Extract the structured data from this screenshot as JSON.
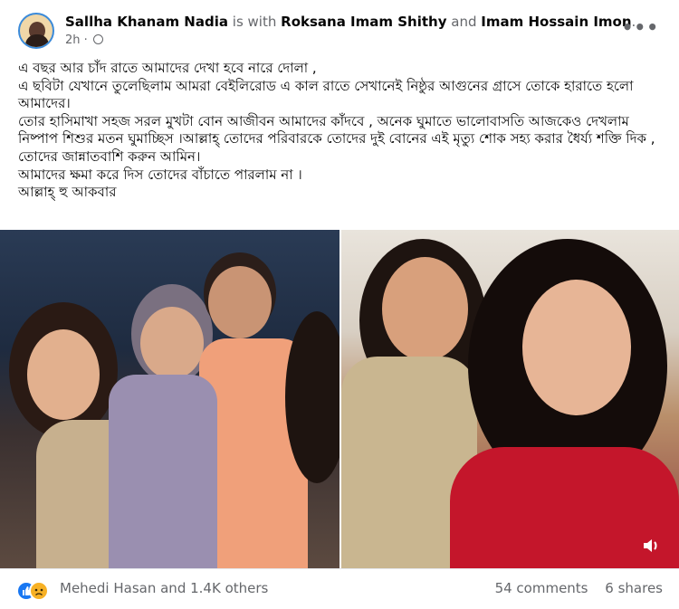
{
  "post": {
    "author": "Sallha Khanam Nadia",
    "with_text": "is with",
    "tagged_1": "Roksana Imam Shithy",
    "and_text": "and",
    "tagged_2": "Imam Hossain Imon",
    "period": ".",
    "time": "2h",
    "dot": "·",
    "more_label": "•••",
    "lines": [
      "এ বছর আর চাঁদ রাতে আমাদের দেখা হবে নারে দোলা ,",
      "এ ছবিটা যেখানে তুলেছিলাম আমরা বেইলিরোড এ কাল রাতে সেখানেই নিষ্ঠুর আগুনের গ্রাসে তোকে হারাতে হলো আমাদের।",
      "তোর হাসিমাখা সহজ সরল মুখটা বোন আজীবন আমাদের কাঁদবে , অনেক ঘুমাতে ভালোবাসতি আজকেও দেখলাম নিষ্পাপ শিশুর মতন ঘুমাচ্ছিস ।আল্লাহ্ তোদের পরিবারকে তোদের দুই বোনের এই মৃত্যু শোক সহ্য করার ধৈর্য্য শক্তি দিক , তোদের জান্নাতবাশি করুন আমিন।",
      "আমাদের ক্ষমা করে দিস তোদের বাঁচাতে পারলাম না ।",
      "আল্লাহ্ হু আকবার"
    ]
  },
  "footer": {
    "reactions_text": "Mehedi Hasan and 1.4K others",
    "comments": "54 comments",
    "shares": "6 shares"
  },
  "colors": {
    "like": "#1877f2",
    "sad": "#f7b125",
    "muted": "#65676b"
  }
}
